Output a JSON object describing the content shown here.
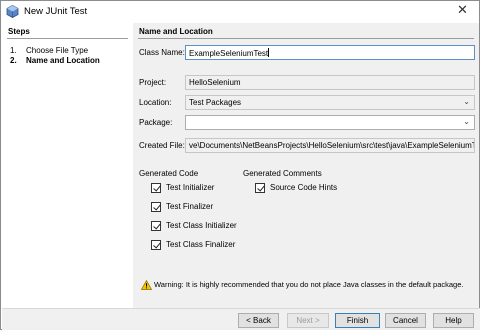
{
  "window": {
    "title": "New JUnit Test"
  },
  "steps": {
    "title": "Steps",
    "items": [
      {
        "num": "1.",
        "label": "Choose File Type"
      },
      {
        "num": "2.",
        "label": "Name and Location"
      }
    ]
  },
  "main": {
    "section_title": "Name and Location",
    "class_name": {
      "label": "Class Name:",
      "value": "ExampleSeleniumTest"
    },
    "project": {
      "label": "Project:",
      "value": "HelloSelenium"
    },
    "location": {
      "label": "Location:",
      "value": "Test Packages"
    },
    "package": {
      "label": "Package:",
      "value": ""
    },
    "created_file": {
      "label": "Created File:",
      "value": "ve\\Documents\\NetBeansProjects\\HelloSelenium\\src\\test\\java\\ExampleSeleniumTest.java"
    }
  },
  "generated_code": {
    "title": "Generated Code",
    "options": [
      {
        "label": "Test Initializer",
        "checked": true
      },
      {
        "label": "Test Finalizer",
        "checked": true
      },
      {
        "label": "Test Class Initializer",
        "checked": true
      },
      {
        "label": "Test Class Finalizer",
        "checked": true
      }
    ]
  },
  "generated_comments": {
    "title": "Generated Comments",
    "options": [
      {
        "label": "Source Code Hints",
        "checked": true
      }
    ]
  },
  "warning": "Warning: It is highly recommended that you do not place Java classes in the default package.",
  "buttons": {
    "back": "< Back",
    "next": "Next >",
    "finish": "Finish",
    "cancel": "Cancel",
    "help": "Help"
  },
  "icons": {
    "app": "netbeans-cube-icon",
    "close": "close-icon",
    "warning": "warning-icon",
    "dropdown": "chevron-down-icon"
  },
  "colors": {
    "accent": "#3c7fb1",
    "warning": "#f2c200"
  }
}
